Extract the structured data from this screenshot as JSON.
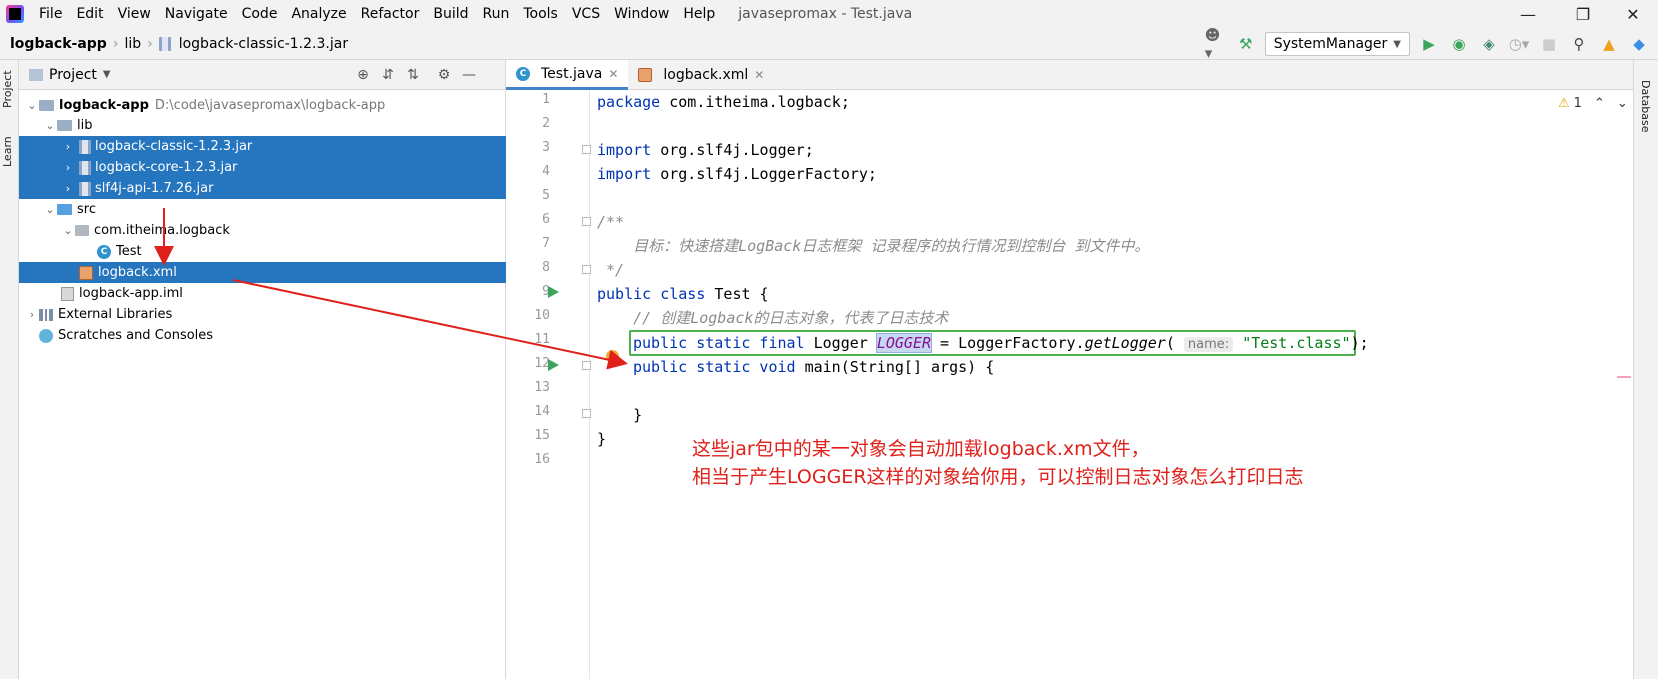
{
  "menubar": {
    "items": [
      "File",
      "Edit",
      "View",
      "Navigate",
      "Code",
      "Analyze",
      "Refactor",
      "Build",
      "Run",
      "Tools",
      "VCS",
      "Window",
      "Help"
    ],
    "window_title": "javasepromax - Test.java"
  },
  "breadcrumb": [
    "logback-app",
    "lib",
    "logback-classic-1.2.3.jar"
  ],
  "toolbar": {
    "run_config": "SystemManager"
  },
  "left_strip": {
    "project_tab": "Project",
    "learn_tab": "Learn"
  },
  "right_strip": {
    "database_tab": "Database"
  },
  "project_panel": {
    "title": "Project",
    "tree": [
      {
        "label": "logback-app",
        "path": "D:\\code\\javasepromax\\logback-app"
      },
      {
        "label": "lib"
      },
      {
        "label": "logback-classic-1.2.3.jar"
      },
      {
        "label": "logback-core-1.2.3.jar"
      },
      {
        "label": "slf4j-api-1.7.26.jar"
      },
      {
        "label": "src"
      },
      {
        "label": "com.itheima.logback"
      },
      {
        "label": "Test"
      },
      {
        "label": "logback.xml"
      },
      {
        "label": "logback-app.iml"
      },
      {
        "label": "External Libraries"
      },
      {
        "label": "Scratches and Consoles"
      }
    ]
  },
  "editor": {
    "tabs": [
      {
        "label": "Test.java",
        "active": true
      },
      {
        "label": "logback.xml",
        "active": false
      }
    ],
    "warnings": "1",
    "line_numbers": [
      "1",
      "2",
      "3",
      "4",
      "5",
      "6",
      "7",
      "8",
      "9",
      "10",
      "11",
      "12",
      "13",
      "14",
      "15",
      "16"
    ],
    "code": {
      "l1_kw": "package",
      "l1_rest": " com.itheima.logback;",
      "l3_kw": "import",
      "l3_rest": " org.slf4j.Logger;",
      "l4_kw": "import",
      "l4_rest": " org.slf4j.LoggerFactory;",
      "l6": "/**",
      "l7": "    目标：快速搭建LogBack日志框架 记录程序的执行情况到控制台 到文件中。",
      "l8": " */",
      "l9_kw": "public class",
      "l9_rest": " Test {",
      "l10": "    // 创建Logback的日志对象，代表了日志技术",
      "l11_kw": "public static final",
      "l11_type": " Logger ",
      "l11_field": "LOGGER",
      "l11_mid": " = LoggerFactory.",
      "l11_method": "getLogger",
      "l11_paren": "(",
      "l11_hint": "name:",
      "l11_str": "\"Test.class\"",
      "l11_end": ");",
      "l12_kw": "public static void",
      "l12_rest": " main(String[] args) {",
      "l14": "    }",
      "l15": "}"
    }
  },
  "annotation": {
    "line1": "这些jar包中的某一对象会自动加载logback.xm文件，",
    "line2": "相当于产生LOGGER这样的对象给你用，可以控制日志对象怎么打印日志"
  },
  "colors": {
    "accent": "#2675bf",
    "annotation": "#e0201a",
    "highlight_box": "#4caf50"
  }
}
